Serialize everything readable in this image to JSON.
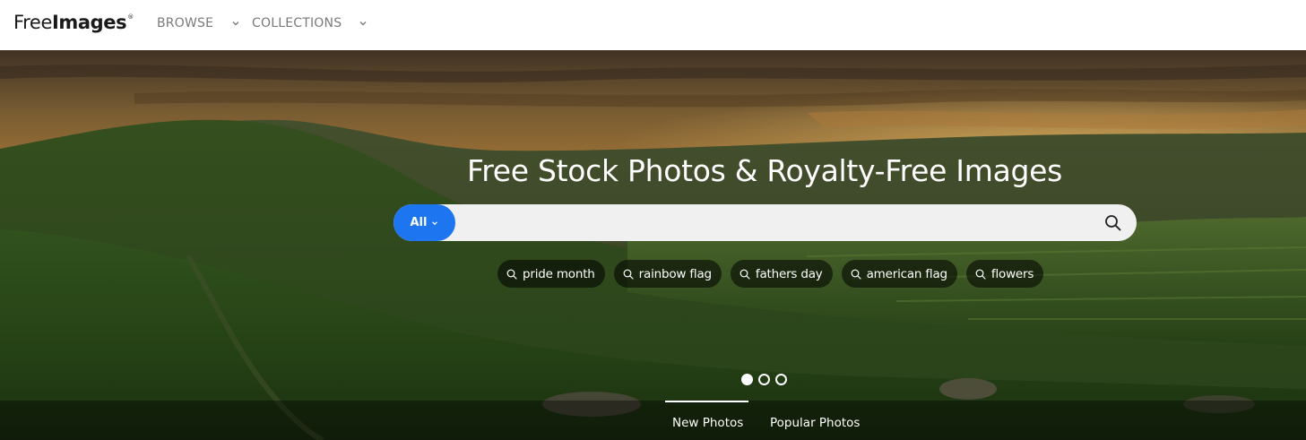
{
  "header": {
    "logo": {
      "light": "Free",
      "bold": "Images",
      "mark": "®"
    },
    "nav": [
      {
        "label": "BROWSE",
        "icon": "chevron-down-icon"
      },
      {
        "label": "COLLECTIONS",
        "icon": "chevron-down-icon"
      }
    ]
  },
  "hero": {
    "title": "Free Stock Photos & Royalty-Free Images",
    "search": {
      "scope": "All",
      "scope_icon": "chevron-down-icon",
      "value": "",
      "placeholder": "",
      "submit_icon": "search-icon"
    },
    "suggestions": [
      {
        "label": "pride month",
        "icon": "search-icon"
      },
      {
        "label": "rainbow flag",
        "icon": "search-icon"
      },
      {
        "label": "fathers day",
        "icon": "search-icon"
      },
      {
        "label": "american flag",
        "icon": "search-icon"
      },
      {
        "label": "flowers",
        "icon": "search-icon"
      }
    ],
    "carousel": {
      "count": 3,
      "active": 1
    },
    "tabs": [
      {
        "label": "New Photos",
        "active": true
      },
      {
        "label": "Popular Photos",
        "active": false
      }
    ]
  },
  "colors": {
    "accent": "#1e75f0",
    "header_text": "#7a7a7a",
    "search_bg": "#f0f0f0",
    "chip_bg": "rgba(0,0,0,0.55)"
  }
}
